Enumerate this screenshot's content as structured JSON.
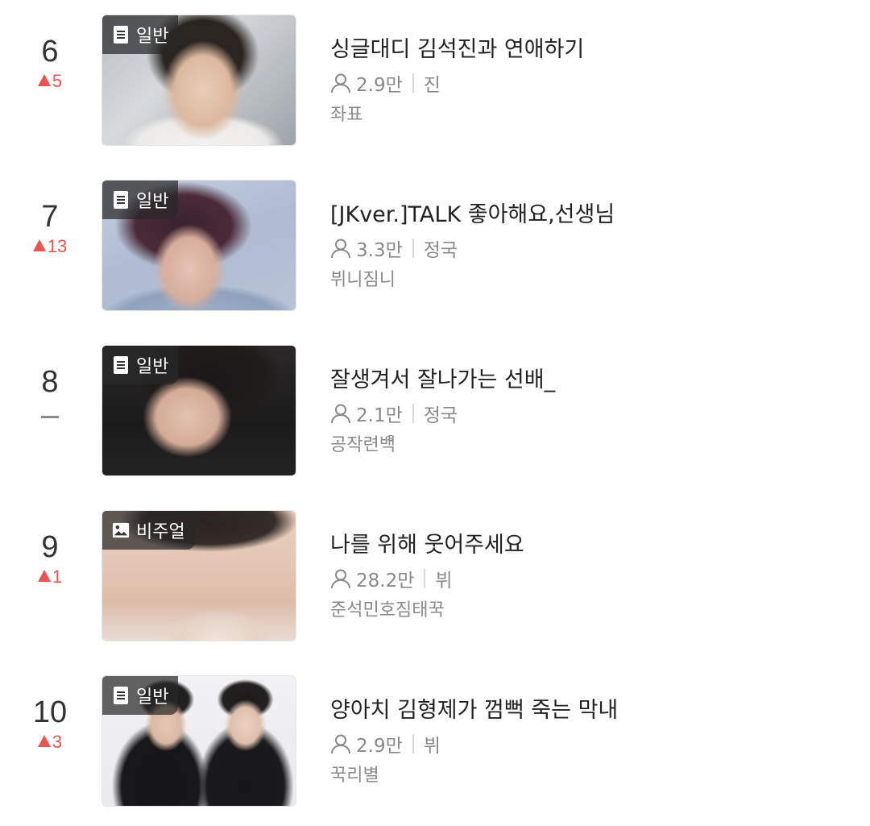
{
  "colors": {
    "rank_up": "#ef5350",
    "rank_same": "#8a8a8a",
    "meta_text": "#8a8a8a",
    "title_text": "#222222"
  },
  "items": [
    {
      "rank": "6",
      "change": "5",
      "change_dir": "up",
      "category": "일반",
      "category_icon": "document-icon",
      "title": "싱글대디 김석진과 연애하기",
      "views": "2.9만",
      "member": "진",
      "author": "좌표"
    },
    {
      "rank": "7",
      "change": "13",
      "change_dir": "up",
      "category": "일반",
      "category_icon": "document-icon",
      "title": "[JKver.]TALK 좋아해요,선생님",
      "views": "3.3만",
      "member": "정국",
      "author": "뷔니짐니"
    },
    {
      "rank": "8",
      "change": "",
      "change_dir": "same",
      "category": "일반",
      "category_icon": "document-icon",
      "title": "잘생겨서 잘나가는 선배_",
      "views": "2.1만",
      "member": "정국",
      "author": "공작련백ꩰ"
    },
    {
      "rank": "9",
      "change": "1",
      "change_dir": "up",
      "category": "비주얼",
      "category_icon": "image-icon",
      "title": "나를 위해 웃어주세요",
      "views": "28.2만",
      "member": "뷔",
      "author": "준석민호짐태꾹"
    },
    {
      "rank": "10",
      "change": "3",
      "change_dir": "up",
      "category": "일반",
      "category_icon": "document-icon",
      "title": "양아치 김형제가 껌뻑 죽는 막내",
      "views": "2.9만",
      "member": "뷔",
      "author": "꾹리별"
    }
  ]
}
